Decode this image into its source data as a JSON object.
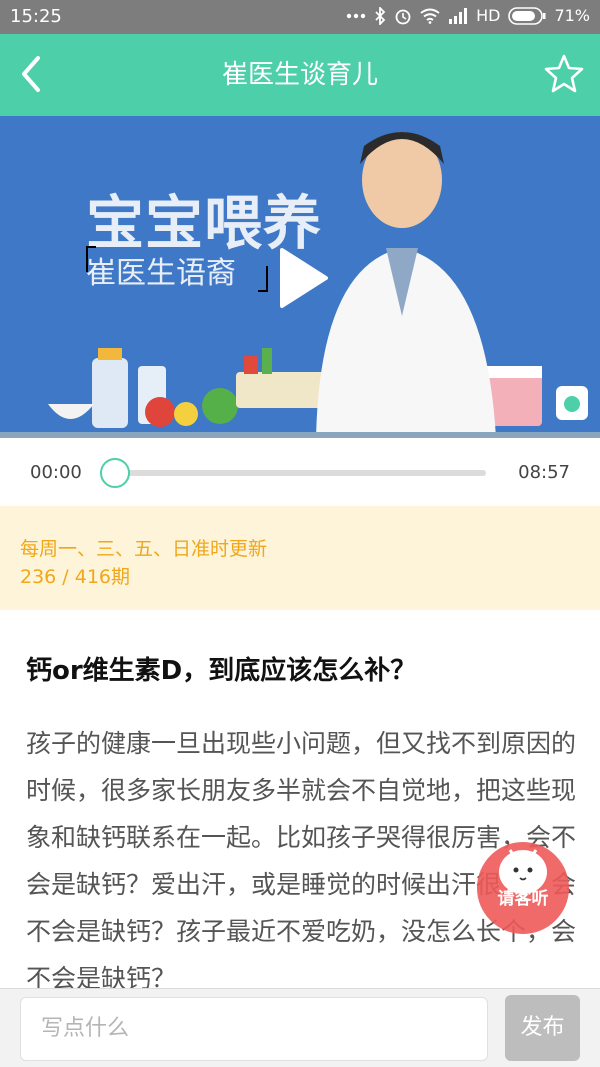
{
  "status_bar": {
    "time": "15:25",
    "network": "HD",
    "battery": "71%"
  },
  "header": {
    "title": "崔医生谈育儿",
    "back_icon": "chevron-left-icon",
    "favorite_icon": "star-icon"
  },
  "video": {
    "headline": "宝宝喂养",
    "subline": "崔医生语裔",
    "play_icon": "play-icon"
  },
  "player": {
    "current_time": "00:00",
    "duration": "08:57",
    "progress": 0
  },
  "info": {
    "schedule": "每周一、三、五、日准时更新",
    "episode": "236 / 416期"
  },
  "article": {
    "title": "钙or维生素D，到底应该怎么补？",
    "body": "孩子的健康一旦出现些小问题，但又找不到原因的时候，很多家长朋友多半就会不自觉地，把这些现象和缺钙联系在一起。比如孩子哭得很厉害，会不会是缺钙？爱出汗，或是睡觉的时候出汗很多，会不会是缺钙？孩子最近不爱吃奶，没怎么长个，会不会是缺钙？"
  },
  "badge": {
    "label": "请客听"
  },
  "comment_bar": {
    "placeholder": "写点什么",
    "send_label": "发布"
  },
  "colors": {
    "brand": "#4dcfa9",
    "video_bg": "#3e78c6",
    "info_bg": "#fdf4d9",
    "info_text": "#f0a71b",
    "badge": "#ee5a5a"
  }
}
